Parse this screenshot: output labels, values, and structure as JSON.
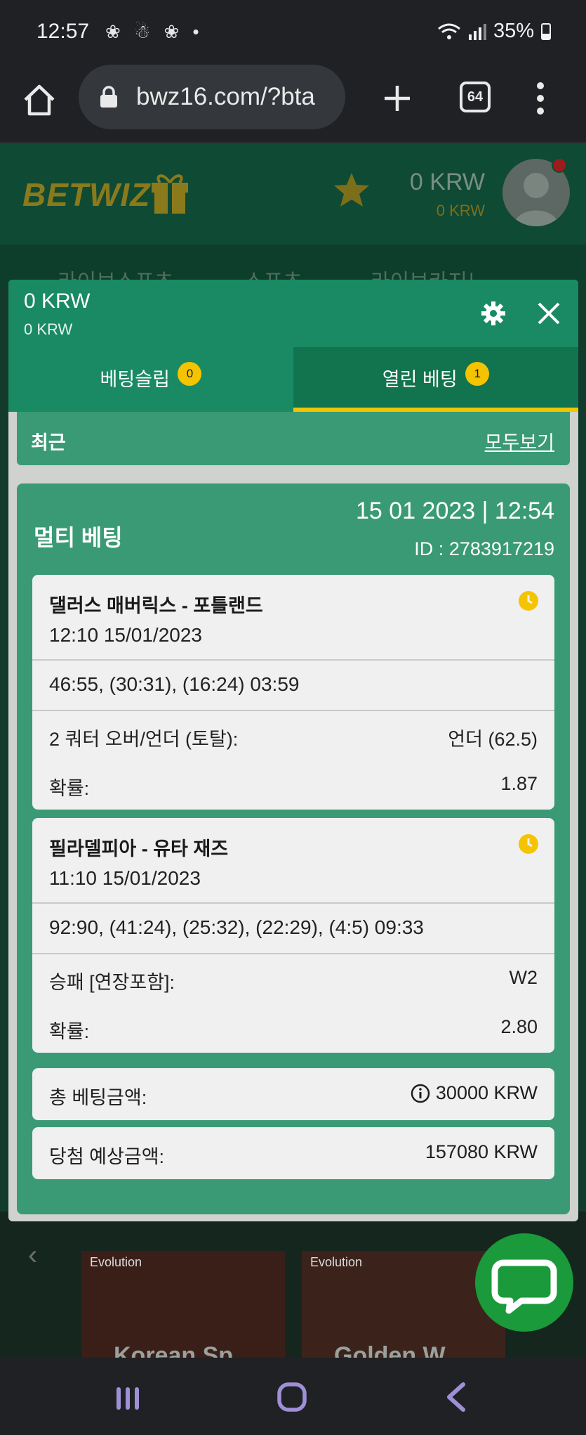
{
  "status_bar": {
    "time": "12:57",
    "notification_icons": "❀ ☃ ❀ •",
    "battery": "35%"
  },
  "browser": {
    "url": "bwz16.com/?bta",
    "tab_count": "64"
  },
  "site": {
    "logo": "BETWIZ",
    "balance_main": "0 KRW",
    "balance_bonus": "0 KRW",
    "nav": [
      "라이브스포츠",
      "스포츠",
      "라이브카지노"
    ],
    "games": [
      {
        "provider": "Evolution",
        "title": "Korean Sp"
      },
      {
        "provider": "Evolution",
        "title": "Golden W"
      }
    ]
  },
  "panel": {
    "balance_main": "0 KRW",
    "balance_bonus": "0 KRW",
    "tabs": [
      {
        "label": "베팅슬립",
        "count": "0"
      },
      {
        "label": "열린 베팅",
        "count": "1"
      }
    ],
    "recent": {
      "title": "최근",
      "view_all": "모두보기"
    },
    "bet": {
      "type": "멀티 베팅",
      "datetime": "15 01 2023 | 12:54",
      "id_label": "ID :",
      "id": "2783917219",
      "matches": [
        {
          "name": "댈러스 매버릭스 - 포틀랜드",
          "time": "12:10   15/01/2023",
          "score": "46:55, (30:31), (16:24) 03:59",
          "market_label": "2 쿼터 오버/언더 (토탈):",
          "market_value": "언더 (62.5)",
          "odds_label": "확률:",
          "odds_value": "1.87"
        },
        {
          "name": "필라델피아 - 유타 재즈",
          "time": "11:10   15/01/2023",
          "score": "92:90, (41:24), (25:32), (22:29), (4:5) 09:33",
          "market_label": "승패 [연장포함]:",
          "market_value": "W2",
          "odds_label": "확률:",
          "odds_value": "2.80"
        }
      ],
      "total_label": "총 베팅금액:",
      "total_value": "30000 KRW",
      "win_label": "당첨 예상금액:",
      "win_value": "157080 KRW"
    }
  },
  "colors": {
    "panel_green": "#198a63",
    "card_green": "#3a9a76",
    "accent_yellow": "#f5c400",
    "chat_green": "#1a9a3a"
  }
}
